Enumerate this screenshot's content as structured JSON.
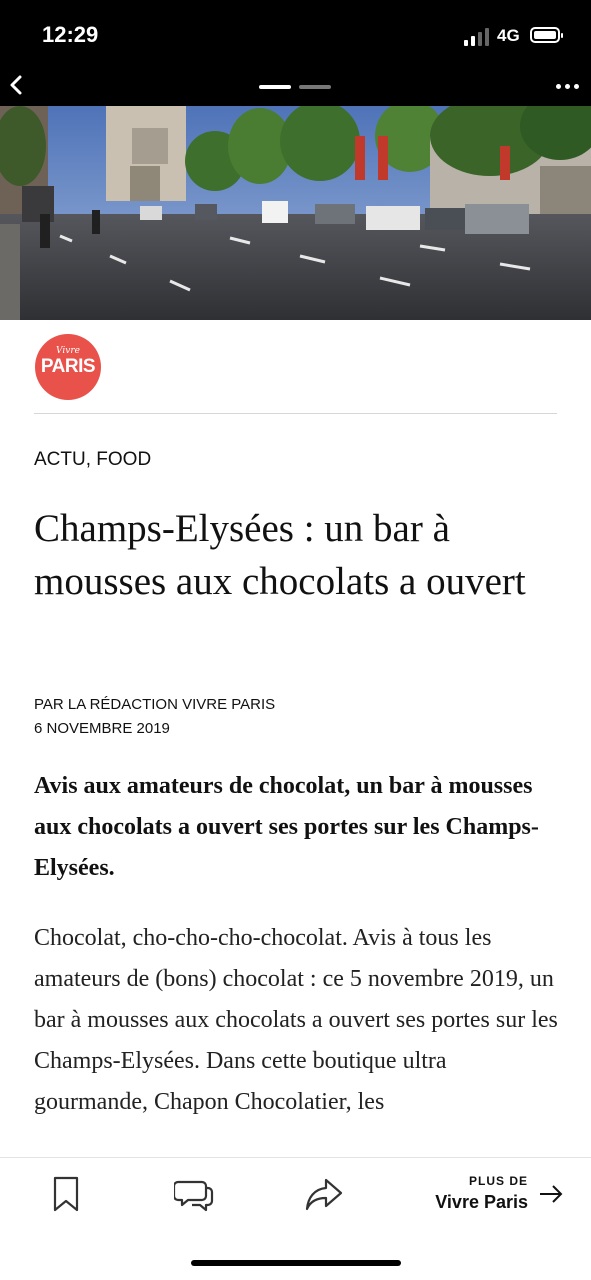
{
  "status_bar": {
    "time": "12:29",
    "network": "4G"
  },
  "nav": {
    "back_icon": "chevron-left-icon",
    "more_icon": "ellipsis-icon",
    "page_indicator": {
      "pages": 2,
      "current": 1
    }
  },
  "hero": {
    "alt": "Champs-Elysées avenue with Arc de Triomphe"
  },
  "publisher": {
    "logo_small": "Vivre",
    "logo_big": "PARIS",
    "color": "#e8524a"
  },
  "article": {
    "category": "ACTU, FOOD",
    "title": "Champs-Elysées : un bar à mousses aux chocolats a ouvert",
    "author": "PAR LA RÉDACTION VIVRE PARIS",
    "date": "6 NOVEMBRE 2019",
    "lead": "Avis aux amateurs de chocolat, un bar à mousses aux chocolats a ouvert ses portes sur les Champs-Elysées.",
    "body": "Chocolat, cho-cho-cho-chocolat. Avis à tous les amateurs de (bons) chocolat : ce 5 novembre 2019, un bar à mousses aux chocolats a ouvert ses portes sur les Champs-Elysées. Dans cette boutique ultra gourmande, Chapon Chocolatier, les"
  },
  "toolbar": {
    "bookmark_icon": "bookmark-icon",
    "comments_icon": "comments-icon",
    "share_icon": "share-icon",
    "more_from_small": "PLUS DE",
    "more_from_big": "Vivre Paris"
  }
}
